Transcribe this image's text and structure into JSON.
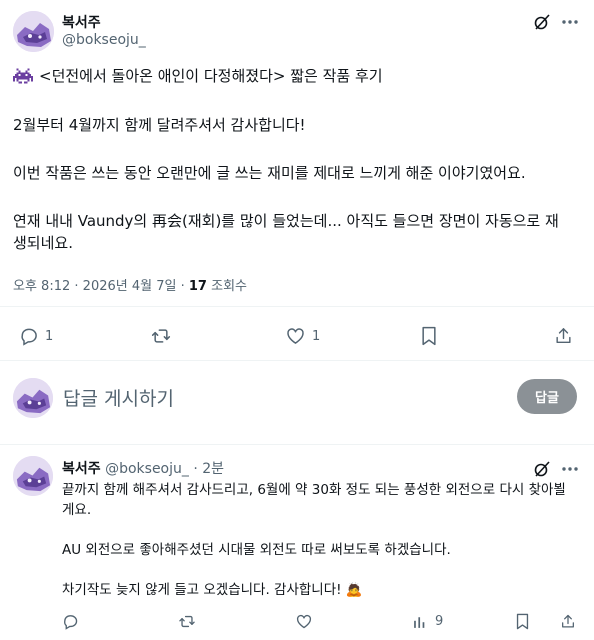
{
  "post": {
    "author_name": "복서주",
    "author_handle": "@bokseoju_",
    "title_line": "<던전에서 돌아온 애인이 다정해졌다> 짧은 작품 후기",
    "para1": "2월부터 4월까지 함께 달려주셔서 감사합니다!",
    "para2": "이번 작품은 쓰는 동안 오랜만에 글 쓰는 재미를 제대로 느끼게 해준 이야기였어요.",
    "para3_line1": "연재 내내 Vaundy의 再会(재회)를 많이 들었는데... 아직도 들으면 장면이 자동으로 재",
    "para3_line2": "생되네요.",
    "time": "오후 8:12",
    "date": "2026년 4월 7일",
    "views_count": "17",
    "views_label": "조회수",
    "reply_count": "1",
    "like_count": "1",
    "dot": "·"
  },
  "compose": {
    "placeholder": "답글 게시하기",
    "button_label": "답글"
  },
  "reply": {
    "author_name": "복서주",
    "author_handle": "@bokseoju_",
    "time": "2분",
    "dot": "·",
    "line1": "끝까지 함께 해주셔서 감사드리고, 6월에 약 30화 정도 되는 풍성한 외전으로 다시 찾아뵐",
    "line2": "게요.",
    "line3": "AU 외전으로 좋아해주셨던 시대물 외전도 따로 써보도록 하겠습니다.",
    "line4": "차기작도 늦지 않게 들고 오겠습니다. 감사합니다!",
    "emoji": "🙇",
    "view_count": "9"
  },
  "icons": {
    "title_emoji": "space-invader-icon",
    "grok": "grok-icon",
    "more": "more-icon",
    "reply": "reply-icon",
    "retweet": "retweet-icon",
    "like": "like-icon",
    "bookmark": "bookmark-icon",
    "share": "share-icon",
    "views": "views-icon"
  },
  "colors": {
    "text": "#0f1419",
    "muted": "#536471",
    "reply_button": "#8b9196",
    "space_invader": "#6b3fa0"
  }
}
